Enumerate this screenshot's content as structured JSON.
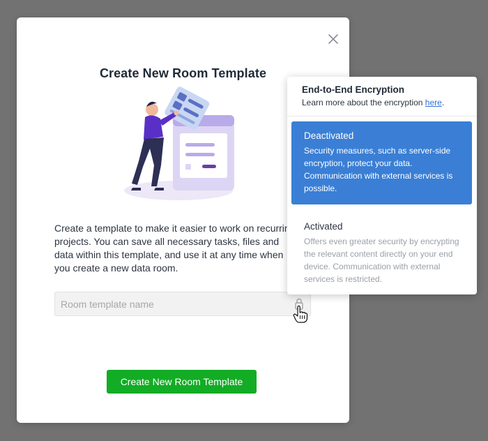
{
  "modal": {
    "title": "Create New Room Template",
    "description": "Create a template to make it easier to work on recurring projects. You can save all necessary tasks, files and data within this template, and use it at any time when you create a new data room.",
    "input_placeholder": "Room template name",
    "primary_button": "Create New Room Template",
    "icons": {
      "close": "close-icon",
      "lock": "lock-icon",
      "cursor": "hand-cursor-icon"
    }
  },
  "encryption_popover": {
    "title": "End-to-End Encryption",
    "subtitle_prefix": "Learn more about the encryption ",
    "subtitle_link": "here",
    "subtitle_suffix": ".",
    "options": [
      {
        "title": "Deactivated",
        "description": "Security measures, such as server-side encryption, protect your data. Communication with external services is possible.",
        "selected": true
      },
      {
        "title": "Activated",
        "description": "Offers even greater security by encrypting the relevant content directly on your end device. Communication with external services is restricted.",
        "selected": false
      }
    ]
  },
  "colors": {
    "overlay": "#727272",
    "primary_button": "#13ac25",
    "selected_option": "#3a7fd5",
    "link": "#2d6fd6"
  }
}
